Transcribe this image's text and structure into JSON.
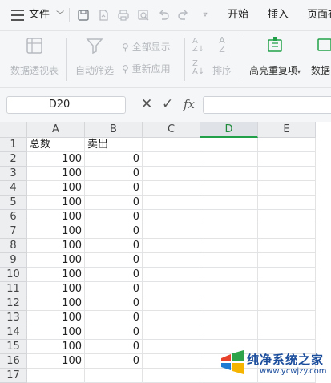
{
  "menubar": {
    "file_label": "文件",
    "tabs": [
      "开始",
      "插入",
      "页面布"
    ]
  },
  "ribbon": {
    "pivot_table": "数据透视表",
    "auto_filter": "自动筛选",
    "show_all": "全部显示",
    "reapply": "重新应用",
    "sort": "排序",
    "highlight_dup": "高亮重复项",
    "data_partial": "数据"
  },
  "formula_bar": {
    "name_box": "D20",
    "fx_label": "fx",
    "formula_value": ""
  },
  "sheet": {
    "selected_column": "D",
    "columns": [
      "A",
      "B",
      "C",
      "D",
      "E"
    ],
    "row_numbers": [
      "1",
      "2",
      "3",
      "4",
      "5",
      "6",
      "7",
      "8",
      "9",
      "10",
      "11",
      "12",
      "13",
      "14",
      "15",
      "16",
      "17"
    ],
    "header_row": {
      "A": "总数",
      "B": "卖出"
    },
    "data_rows": [
      {
        "A": "100",
        "B": "0"
      },
      {
        "A": "100",
        "B": "0"
      },
      {
        "A": "100",
        "B": "0"
      },
      {
        "A": "100",
        "B": "0"
      },
      {
        "A": "100",
        "B": "0"
      },
      {
        "A": "100",
        "B": "0"
      },
      {
        "A": "100",
        "B": "0"
      },
      {
        "A": "100",
        "B": "0"
      },
      {
        "A": "100",
        "B": "0"
      },
      {
        "A": "100",
        "B": "0"
      },
      {
        "A": "100",
        "B": "0"
      },
      {
        "A": "100",
        "B": "0"
      },
      {
        "A": "100",
        "B": "0"
      },
      {
        "A": "100",
        "B": "0"
      },
      {
        "A": "100",
        "B": "0"
      }
    ]
  },
  "watermark": {
    "title": "纯净系统之家",
    "url": "www.ycwjzy.com"
  },
  "colors": {
    "accent_green": "#21a049",
    "watermark_blue": "#1a4c9c"
  }
}
